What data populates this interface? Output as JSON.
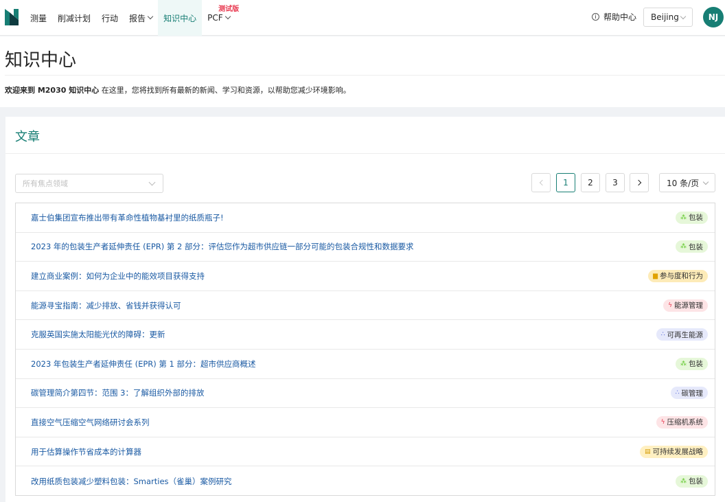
{
  "nav": {
    "items": [
      {
        "label": "测量",
        "has_dropdown": false,
        "active": false
      },
      {
        "label": "削减计划",
        "has_dropdown": false,
        "active": false
      },
      {
        "label": "行动",
        "has_dropdown": false,
        "active": false
      },
      {
        "label": "报告",
        "has_dropdown": true,
        "active": false
      },
      {
        "label": "知识中心",
        "has_dropdown": false,
        "active": true
      },
      {
        "label": "PCF",
        "has_dropdown": true,
        "active": false,
        "badge": "测试版"
      }
    ],
    "help_label": "帮助中心",
    "region": "Beijing",
    "avatar_initials": "NJ"
  },
  "header": {
    "title": "知识中心",
    "welcome_bold": "欢迎来到 M2030 知识中心",
    "welcome_rest": " 在这里，您将找到所有最新的新闻、学习和资源，以帮助您减少环境影响。"
  },
  "articles": {
    "section_title": "文章",
    "filter_placeholder": "所有焦点领域",
    "pagination": {
      "pages": [
        "1",
        "2",
        "3"
      ],
      "current": "1",
      "page_size": "10 条/页"
    },
    "items": [
      {
        "title": "嘉士伯集团宣布推出带有革命性植物基衬里的纸质瓶子!",
        "tag": "包装",
        "tag_color": "green",
        "tag_icon": "packaging-icon"
      },
      {
        "title": "2023 年的包装生产者延伸责任 (EPR) 第 2 部分：评估您作为超市供应链一部分可能的包装合规性和数据要求",
        "tag": "包装",
        "tag_color": "green",
        "tag_icon": "packaging-icon"
      },
      {
        "title": "建立商业案例：如何为企业中的能效项目获得支持",
        "tag": "参与度和行为",
        "tag_color": "yellow",
        "tag_icon": "folder-icon"
      },
      {
        "title": "能源寻宝指南：减少排放、省钱并获得认可",
        "tag": "能源管理",
        "tag_color": "red",
        "tag_icon": "lightning-icon"
      },
      {
        "title": "克服英国实施太阳能光伏的障碍：更新",
        "tag": "可再生能源",
        "tag_color": "blue",
        "tag_icon": "dots-icon"
      },
      {
        "title": "2023 年包装生产者延伸责任 (EPR) 第 1 部分：超市供应商概述",
        "tag": "包装",
        "tag_color": "green",
        "tag_icon": "packaging-icon"
      },
      {
        "title": "碳管理简介第四节：范围 3：了解组织外部的排放",
        "tag": "碳管理",
        "tag_color": "blue",
        "tag_icon": "dots-icon"
      },
      {
        "title": "直接空气压缩空气网络研讨会系列",
        "tag": "压缩机系统",
        "tag_color": "red",
        "tag_icon": "lightning-icon"
      },
      {
        "title": "用于估算操作节省成本的计算器",
        "tag": "可持续发展战略",
        "tag_color": "lyellow",
        "tag_icon": "document-icon"
      },
      {
        "title": "改用纸质包装减少塑料包装：Smarties（雀巢）案例研究",
        "tag": "包装",
        "tag_color": "green",
        "tag_icon": "packaging-icon"
      }
    ]
  },
  "colors": {
    "brand": "#177e74",
    "link": "#1a5aa3",
    "beta": "#e8384f"
  }
}
